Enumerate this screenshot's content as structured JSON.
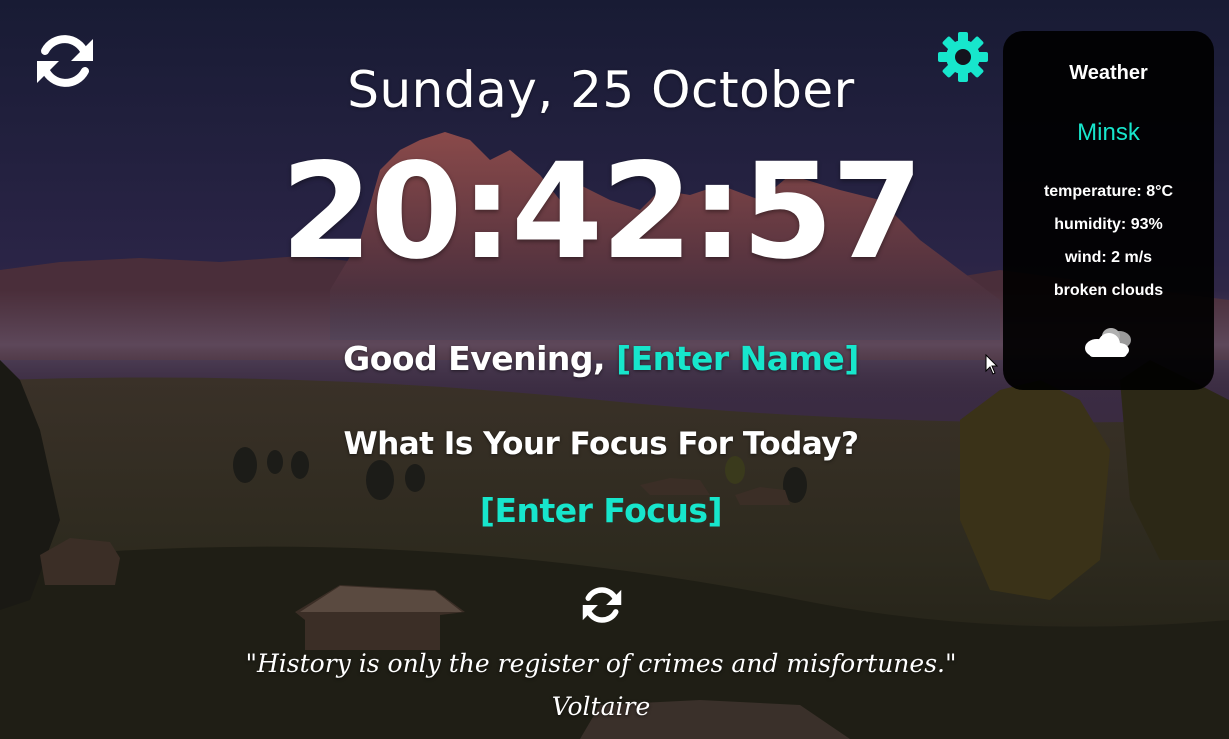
{
  "date": "Sunday, 25 October",
  "time": "20:42:57",
  "greeting": {
    "text": "Good Evening, ",
    "name": "[Enter Name]"
  },
  "focus": {
    "question": "What Is Your Focus For Today?",
    "value": "[Enter Focus]"
  },
  "quote": {
    "text": "\"History is only the register of crimes and misfortunes.\"",
    "author": "Voltaire"
  },
  "weather": {
    "title": "Weather",
    "city": "Minsk",
    "temperature": "temperature: 8°C",
    "humidity": "humidity: 93%",
    "wind": "wind: 2 m/s",
    "description": "broken clouds",
    "icon": "broken-clouds-icon"
  },
  "icons": {
    "refresh_background": "refresh-icon",
    "settings": "gear-icon",
    "refresh_quote": "refresh-icon"
  },
  "colors": {
    "accent": "#17e6cc",
    "text": "#ffffff",
    "card_background": "#000000"
  }
}
